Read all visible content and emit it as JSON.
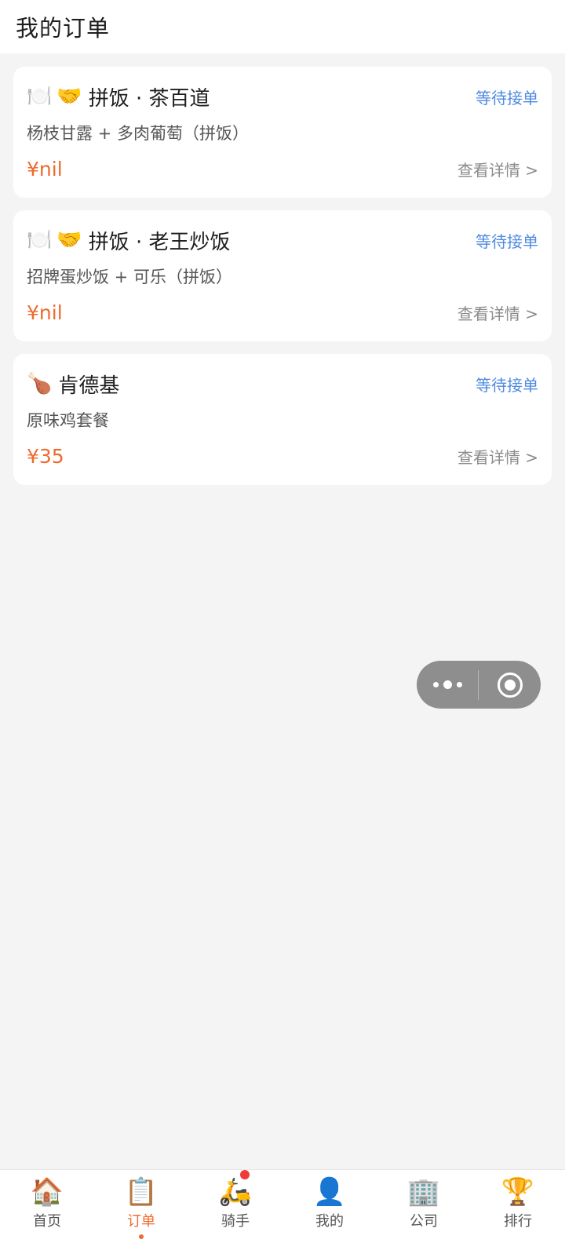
{
  "header": {
    "title": "我的订单"
  },
  "orders": [
    {
      "icons": [
        "🍽️",
        "🤝"
      ],
      "shop_name": "拼饭 · 茶百道",
      "status": "等待接单",
      "items": "杨枝甘露 + 多肉葡萄（拼饭）",
      "price": "¥nil",
      "detail_label": "查看详情 >"
    },
    {
      "icons": [
        "🍽️",
        "🤝"
      ],
      "shop_name": "拼饭 · 老王炒饭",
      "status": "等待接单",
      "items": "招牌蛋炒饭 + 可乐（拼饭）",
      "price": "¥nil",
      "detail_label": "查看详情 >"
    },
    {
      "icons": [
        "🍗"
      ],
      "shop_name": "肯德基",
      "status": "等待接单",
      "items": "原味鸡套餐",
      "price": "¥35",
      "detail_label": "查看详情 >"
    }
  ],
  "tabbar": [
    {
      "icon": "🏠",
      "label": "首页"
    },
    {
      "icon": "📋",
      "label": "订单",
      "active": true
    },
    {
      "icon": "🛵",
      "label": "骑手",
      "badge": true
    },
    {
      "icon": "👤",
      "label": "我的"
    },
    {
      "icon": "🏢",
      "label": "公司"
    },
    {
      "icon": "🏆",
      "label": "排行"
    }
  ],
  "colors": {
    "accent": "#ef6a2c",
    "status": "#4f8ae0",
    "badge": "#ef3a3a"
  }
}
